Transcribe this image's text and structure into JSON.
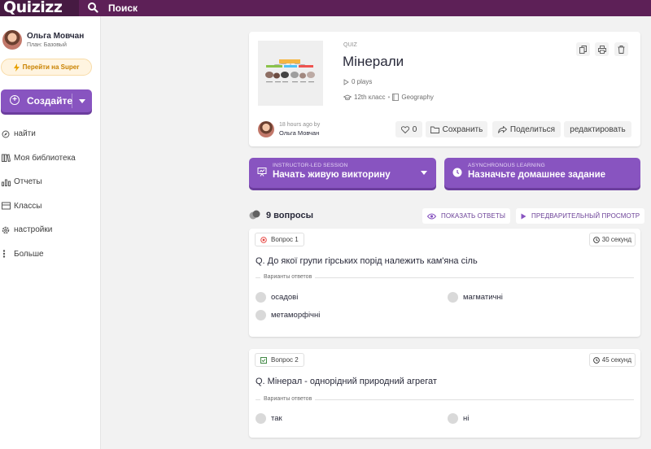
{
  "topbar": {
    "logo": "Quizizz",
    "search_placeholder": "Поиск"
  },
  "sidebar": {
    "user_name": "Ольга Мовчан",
    "user_plan": "План: Базовый",
    "super_label": "Перейти на Super",
    "create_label": "Создайте",
    "nav": [
      {
        "label": "найти",
        "icon": "compass-icon"
      },
      {
        "label": "Моя библиотека",
        "icon": "library-icon"
      },
      {
        "label": "Отчеты",
        "icon": "reports-icon"
      },
      {
        "label": "Классы",
        "icon": "classes-icon"
      },
      {
        "label": "настройки",
        "icon": "settings-icon"
      },
      {
        "label": "Больше",
        "icon": "more-icon"
      }
    ]
  },
  "quiz": {
    "type": "QUIZ",
    "title": "Мінерали",
    "plays": "0 plays",
    "grade": "12th класс",
    "subject": "Geography",
    "author_time": "18 hours ago by",
    "author_name": "Ольга Мовчан",
    "likes": "0",
    "save_label": "Сохранить",
    "share_label": "Поделиться",
    "edit_label": "редактировать"
  },
  "play": {
    "live_sub": "INSTRUCTOR-LED SESSION",
    "live_main": "Начать живую викторину",
    "hw_sub": "ASYNCHRONOUS LEARNING",
    "hw_main": "Назначьте домашнее задание"
  },
  "questions_header": {
    "count": "9 вопросы",
    "show_answers": "ПОКАЗАТЬ ОТВЕТЫ",
    "preview": "ПРЕДВАРИТЕЛЬНЫЙ ПРОСМОТР"
  },
  "questions": [
    {
      "num": "Вопрос 1",
      "time": "30 секунд",
      "text": "Q. До якої групи гірських порід належить кам'яна сіль",
      "answers_label": "Варианты ответов",
      "options": [
        "осадові",
        "магматичні",
        "метаморфічні"
      ]
    },
    {
      "num": "Вопрос 2",
      "time": "45 секунд",
      "text": "Q. Мінерал - однорідний природний агрегат",
      "answers_label": "Варианты ответов",
      "options": [
        "так",
        "ні"
      ]
    }
  ]
}
